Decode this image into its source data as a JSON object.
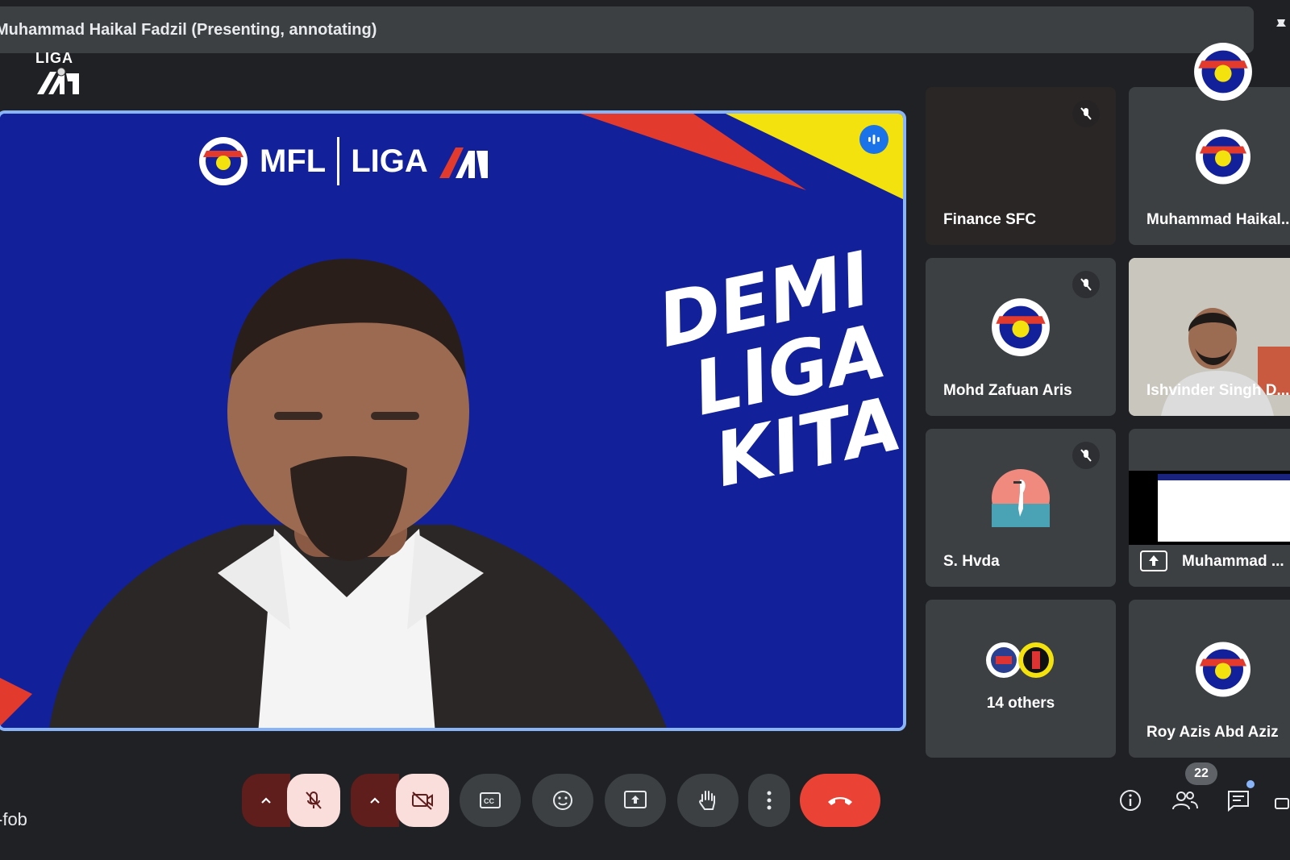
{
  "presenter_banner": "Muhammad Haikal Fadzil (Presenting, annotating)",
  "logo": {
    "text": "LIGA"
  },
  "main_video": {
    "banner_left": "MFL",
    "banner_right": "LIGA",
    "slogan_line1": "DEMI",
    "slogan_line2": "LIGA",
    "slogan_line3": "KITA",
    "bg_color": "#12209a"
  },
  "participants": [
    {
      "name": "Finance SFC",
      "muted": true
    },
    {
      "name": "Muhammad Haikal...",
      "muted": true
    },
    {
      "name": "Mohd Zafuan Aris",
      "muted": true
    },
    {
      "name": "Ishvinder Singh D...",
      "muted": true
    },
    {
      "name": "S. Hvda",
      "muted": true
    },
    {
      "name": "Muhammad ...",
      "presenting": true
    },
    {
      "name": "14 others"
    },
    {
      "name": "Roy Azis Abd Aziz",
      "muted": true
    }
  ],
  "bottom": {
    "meeting_code": "-fob",
    "people_count": "22"
  },
  "colors": {
    "accent_blue": "#8ab4f8",
    "end_call_red": "#ea4335",
    "muted_pink": "#f9dedc"
  }
}
